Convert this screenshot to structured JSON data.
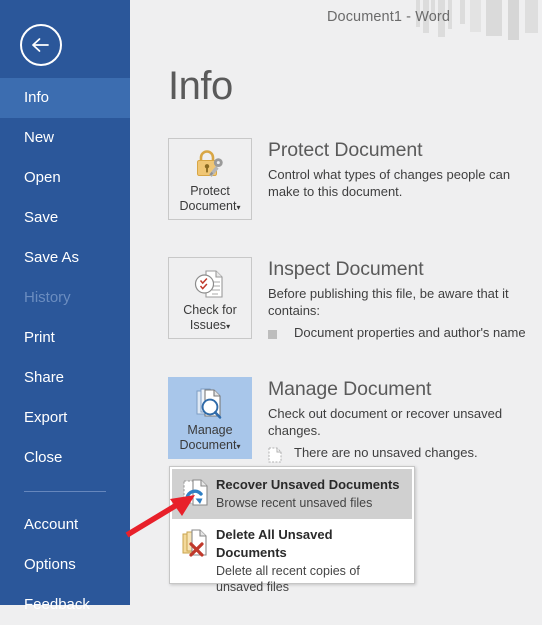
{
  "titlebar": {
    "document_title": "Document1 - Word"
  },
  "sidebar": {
    "back_button": "back-arrow-icon",
    "items": [
      {
        "label": "Info",
        "state": "active"
      },
      {
        "label": "New",
        "state": "normal"
      },
      {
        "label": "Open",
        "state": "normal"
      },
      {
        "label": "Save",
        "state": "normal"
      },
      {
        "label": "Save As",
        "state": "normal"
      },
      {
        "label": "History",
        "state": "disabled"
      },
      {
        "label": "Print",
        "state": "normal"
      },
      {
        "label": "Share",
        "state": "normal"
      },
      {
        "label": "Export",
        "state": "normal"
      },
      {
        "label": "Close",
        "state": "normal"
      },
      {
        "label": "Account",
        "state": "normal"
      },
      {
        "label": "Options",
        "state": "normal"
      },
      {
        "label": "Feedback",
        "state": "normal"
      }
    ]
  },
  "main": {
    "page_title": "Info",
    "protect": {
      "button_line1": "Protect",
      "button_line2": "Document",
      "caret": "▾",
      "heading": "Protect Document",
      "description": "Control what types of changes people can make to this document."
    },
    "inspect": {
      "button_line1": "Check for",
      "button_line2": "Issues",
      "caret": "▾",
      "heading": "Inspect Document",
      "description": "Before publishing this file, be aware that it contains:",
      "bullets": [
        "Document properties and author's name"
      ]
    },
    "manage": {
      "button_line1": "Manage",
      "button_line2": "Document",
      "caret": "▾",
      "heading": "Manage Document",
      "description": "Check out document or recover unsaved changes.",
      "status": "There are no unsaved changes."
    }
  },
  "dropdown": {
    "items": [
      {
        "title": "Recover Unsaved Documents",
        "description": "Browse recent unsaved files",
        "icon": "recover-document-icon",
        "hovered": true
      },
      {
        "title": "Delete All Unsaved Documents",
        "description": "Delete all recent copies of unsaved files",
        "icon": "delete-documents-icon",
        "hovered": false
      }
    ]
  },
  "annotation": {
    "arrow_color": "#e8202a"
  },
  "colors": {
    "sidebar_blue": "#2b579a",
    "sidebar_active_blue": "#3c6db0",
    "tile_highlight": "#a8c6ea",
    "page_background": "#efeff0",
    "arrow_red": "#e8202a"
  }
}
